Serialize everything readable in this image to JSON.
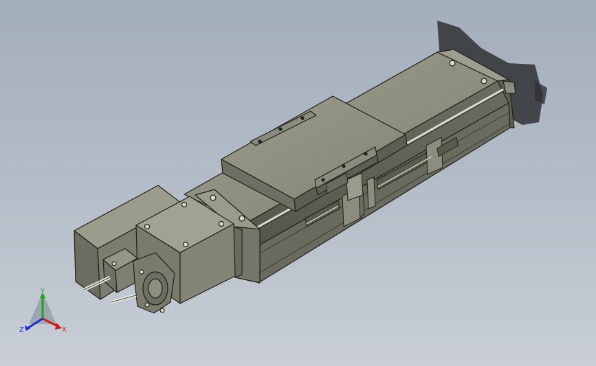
{
  "viewport": {
    "background_top": "#a3aebb",
    "background_bottom": "#c9ced7"
  },
  "model": {
    "body_color": "#7f8070",
    "edge_color": "#1f2019",
    "shadow_color": "#2f3134"
  },
  "triad": {
    "x_label": "X",
    "y_label": "Y",
    "z_label": "Z",
    "x_color": "#d01c1c",
    "y_color": "#1ba51b",
    "z_color": "#1c2dd0"
  }
}
